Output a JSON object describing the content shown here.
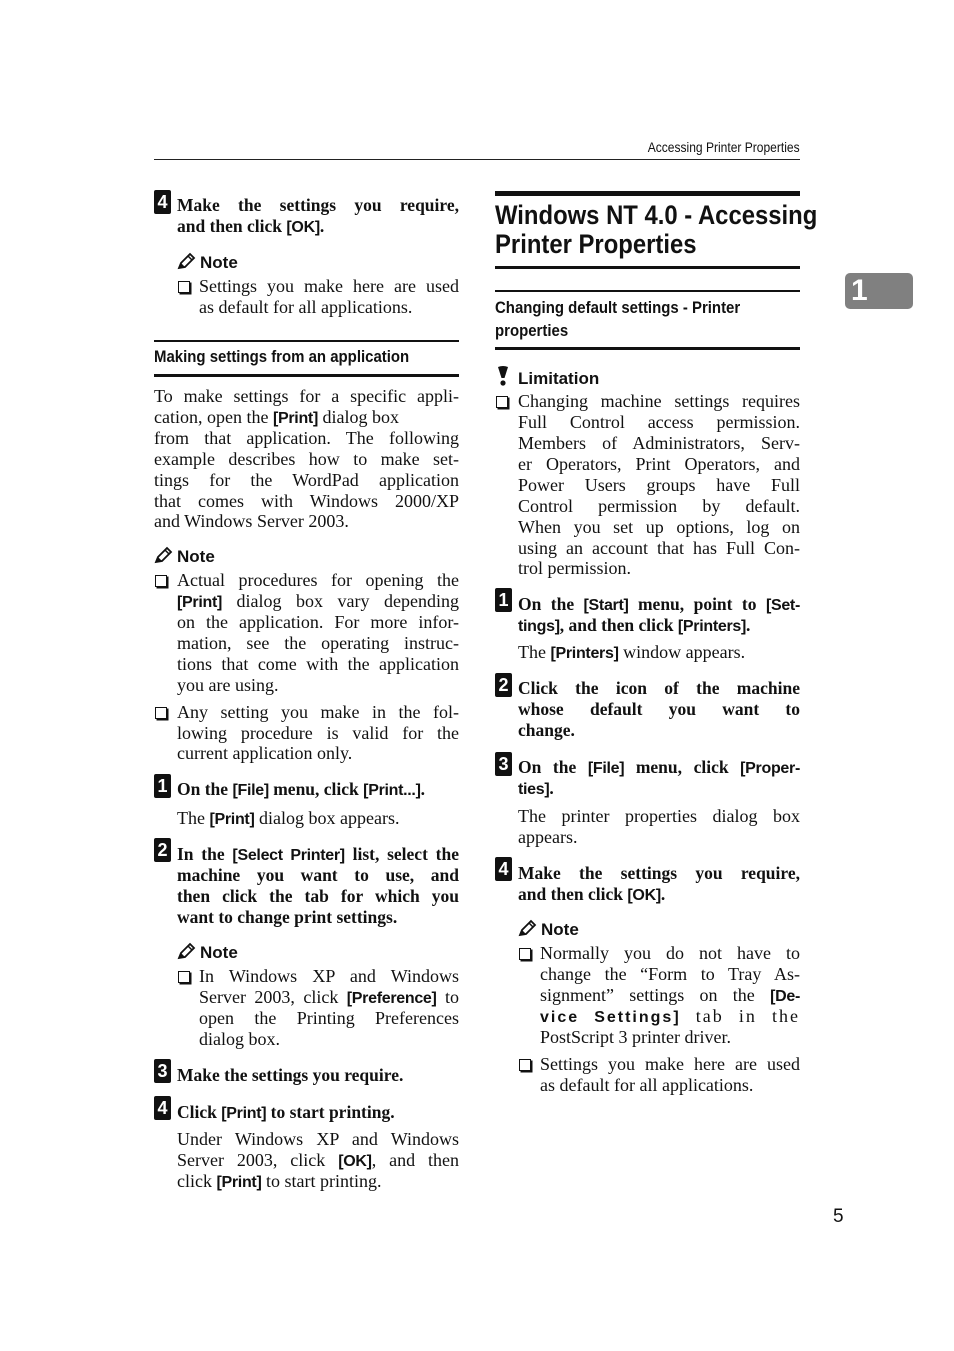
{
  "header": {
    "running_title": "Accessing Printer Properties"
  },
  "chapter_tab": {
    "number": "1"
  },
  "page_number": "5",
  "left": {
    "top_step": {
      "num": "4",
      "text_a": "Make the settings you require,",
      "text_b": "and then click ",
      "ui_ok": "[OK]",
      "end": ".",
      "note_label": "Note",
      "note_line1": "Settings you make here are used",
      "note_line2": "as default for all applications."
    },
    "section": {
      "heading": "Making settings from an application",
      "intro": [
        "To make settings for a specific appli-",
        "cation, open the ",
        "[Print]",
        " dialog box",
        "from that application. The following",
        "example describes how to make set-",
        "tings for the WordPad application",
        "that comes with Windows 2000/XP",
        "and Windows Server 2003."
      ],
      "note_label": "Note",
      "note1": {
        "l1": "Actual procedures for opening the",
        "l2_ui": "[Print]",
        "l2": " dialog box vary depending",
        "l3": "on the application. For more infor-",
        "l4": "mation, see the operating instruc-",
        "l5": "tions that come with the application",
        "l6": "you are using."
      },
      "note2": {
        "l1": "Any setting you make in the fol-",
        "l2": "lowing procedure is valid for the",
        "l3": "current application only."
      },
      "steps": [
        {
          "num": "1",
          "a": "On the ",
          "ui1": "[File]",
          "b": " menu, click ",
          "ui2": "[Print...]",
          "c": ".",
          "result_a": "The ",
          "result_ui": "[Print]",
          "result_b": " dialog box appears."
        },
        {
          "num": "2",
          "a": "In the ",
          "ui1": "[Select Printer]",
          "b": " list, select the",
          "l2": "machine you want to use, and",
          "l3": "then click the tab for which you",
          "l4": "want to change print settings.",
          "note_label": "Note",
          "note_l1": "In Windows XP and Windows",
          "note_l2a": "Server 2003, click ",
          "note_l2_ui": "[Preference]",
          "note_l2b": " to",
          "note_l3": "open the Printing Preferences",
          "note_l4": "dialog box."
        },
        {
          "num": "3",
          "text": "Make the settings you require."
        },
        {
          "num": "4",
          "a": "Click ",
          "ui1": "[Print]",
          "b": " to start printing.",
          "r1": "Under Windows XP and Windows",
          "r2a": "Server 2003, click ",
          "r2_ui": "[OK]",
          "r2b": ", and then",
          "r3a": "click ",
          "r3_ui": "[Print]",
          "r3b": " to start printing."
        }
      ]
    }
  },
  "right": {
    "title_l1": "Windows NT 4.0 - Accessing",
    "title_l2": "Printer Properties",
    "subheading_l1": "Changing default settings - Printer",
    "subheading_l2": "properties",
    "limitation_label": "Limitation",
    "limitation_lines": [
      "Changing machine settings requires",
      "Full Control access permission.",
      "Members of Administrators, Serv-",
      "er Operators, Print Operators, and",
      "Power Users groups have Full",
      "Control permission by default.",
      "When you set up options, log on",
      "using an account that has Full Con-",
      "trol permission."
    ],
    "steps": [
      {
        "num": "1",
        "a": "On the ",
        "ui1": "[Start]",
        "b": " menu, point to ",
        "ui2": "[Set-",
        "l2_ui": "tings]",
        "l2b": ", and then click ",
        "l2_ui2": "[Printers]",
        "l2c": ".",
        "result_a": "The ",
        "result_ui": "[Printers]",
        "result_b": " window appears."
      },
      {
        "num": "2",
        "l1": "Click the icon of the machine",
        "l2": "whose default you want to",
        "l3": "change."
      },
      {
        "num": "3",
        "a": "On the ",
        "ui1": "[File]",
        "b": " menu, click ",
        "ui2": "[Proper-",
        "l2_ui": "ties]",
        "l2b": ".",
        "r1": "The printer properties dialog box",
        "r2": "appears."
      },
      {
        "num": "4",
        "l1": "Make the settings you require,",
        "l2a": "and then click ",
        "l2_ui": "[OK]",
        "l2b": ".",
        "note_label": "Note",
        "n1_l1": "Normally you do not have to",
        "n1_l2": "change the “Form to Tray As-",
        "n1_l3a": "signment” settings on the ",
        "n1_l3_ui": "[De-",
        "n1_l4_ui": "vice Settings]",
        "n1_l4b": " tab in the",
        "n1_l5": "PostScript 3 printer driver.",
        "n2_l1": "Settings you make here are used",
        "n2_l2": "as default for all applications."
      }
    ]
  }
}
